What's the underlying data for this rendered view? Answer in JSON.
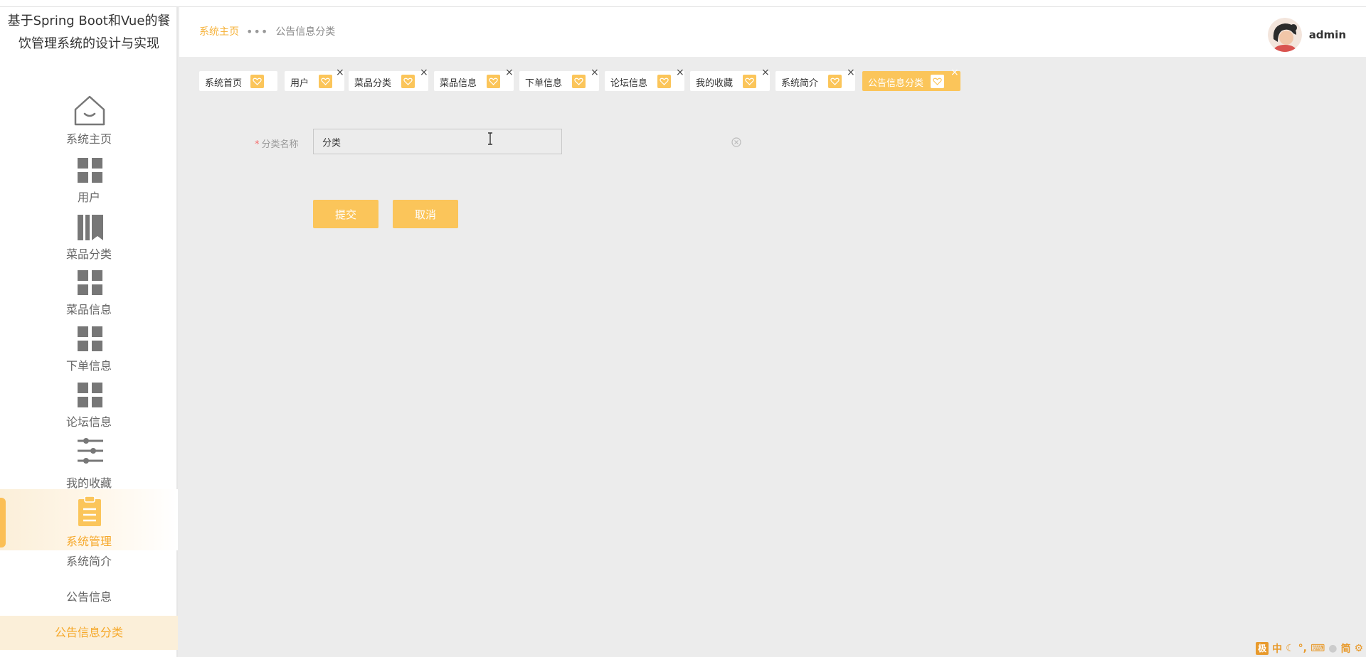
{
  "site": {
    "title": "基于Spring Boot和Vue的餐饮管理系统的设计与实现"
  },
  "sidebar": {
    "items": [
      {
        "label": "系统主页",
        "icon": "home-icon"
      },
      {
        "label": "用户",
        "icon": "grid-icon"
      },
      {
        "label": "菜品分类",
        "icon": "books-icon"
      },
      {
        "label": "菜品信息",
        "icon": "grid-icon"
      },
      {
        "label": "下单信息",
        "icon": "grid-icon"
      },
      {
        "label": "论坛信息",
        "icon": "grid-icon"
      },
      {
        "label": "我的收藏",
        "icon": "sliders-icon"
      },
      {
        "label": "系统管理",
        "icon": "clipboard-icon",
        "active": true
      }
    ],
    "subitems": [
      {
        "label": "系统简介"
      },
      {
        "label": "公告信息"
      },
      {
        "label": "公告信息分类",
        "active": true
      }
    ]
  },
  "header": {
    "breadcrumb": {
      "home": "系统主页",
      "current": "公告信息分类"
    },
    "user": {
      "name": "admin"
    }
  },
  "tabs": [
    {
      "label": "系统首页",
      "closable": false
    },
    {
      "label": "用户",
      "closable": true
    },
    {
      "label": "菜品分类",
      "closable": true
    },
    {
      "label": "菜品信息",
      "closable": true
    },
    {
      "label": "下单信息",
      "closable": true
    },
    {
      "label": "论坛信息",
      "closable": true
    },
    {
      "label": "我的收藏",
      "closable": true
    },
    {
      "label": "系统简介",
      "closable": true
    },
    {
      "label": "公告信息分类",
      "closable": true,
      "active": true
    }
  ],
  "form": {
    "field_label": "分类名称",
    "required_mark": "*",
    "field_value": "分类",
    "submit_label": "提交",
    "cancel_label": "取消"
  },
  "ime": {
    "logo": "极",
    "items": [
      "中",
      "°,",
      "简"
    ]
  },
  "colors": {
    "accent": "#fbc55a",
    "accent_text": "#f6a829",
    "background": "#ececec"
  }
}
